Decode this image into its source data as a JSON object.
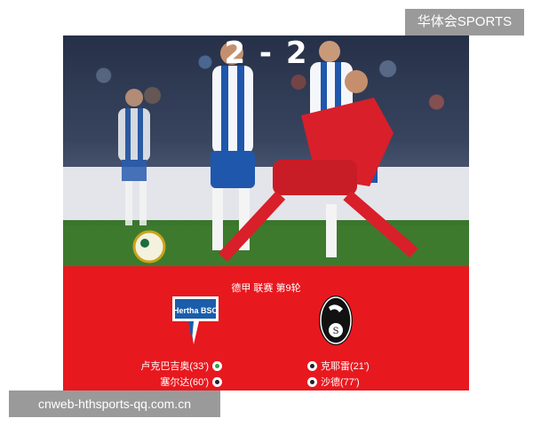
{
  "watermark_top": "华体会SPORTS",
  "watermark_bottom": "cnweb-hthsports-qq.com.cn",
  "match": {
    "league": "德甲 联赛 第9轮",
    "score": "2 - 2",
    "home_badge_text": "Hertha BSC",
    "home_scorers": [
      {
        "text": "卢克巴吉奥(33')",
        "ball": "green"
      },
      {
        "text": "塞尔达(60')",
        "ball": "normal"
      }
    ],
    "away_scorers": [
      {
        "text": "克耶雷(21')",
        "ball": "normal"
      },
      {
        "text": "沙德(77')",
        "ball": "normal"
      }
    ]
  },
  "colors": {
    "score_bg": "#e8181f",
    "hertha_blue": "#1a5dab",
    "freiburg_black": "#111111"
  }
}
